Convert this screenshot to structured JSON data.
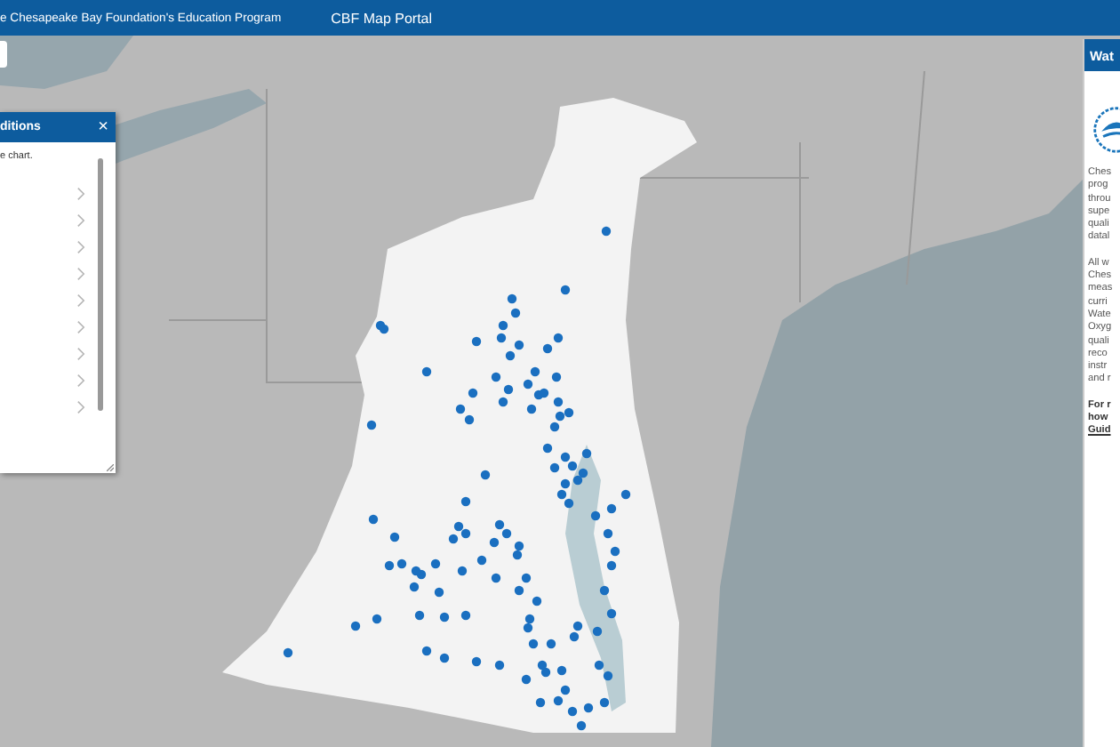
{
  "header": {
    "title": "e Chesapeake Bay Foundation's Education Program",
    "nav": [
      {
        "label": "CBF Map Portal"
      }
    ]
  },
  "left_panel": {
    "title": "ditions",
    "close": "×",
    "text": "e chart.",
    "rows": [
      {
        "kind": "chevron"
      },
      {
        "kind": "chevron"
      },
      {
        "kind": "chevron"
      },
      {
        "kind": "chevron"
      },
      {
        "kind": "chevron"
      },
      {
        "kind": "chevron"
      },
      {
        "kind": "chevron"
      },
      {
        "kind": "chevron"
      },
      {
        "kind": "chevron"
      }
    ]
  },
  "right_panel": {
    "title": "Wat",
    "paragraphs": [
      {
        "kind": "plain",
        "lines": [
          "Ches",
          "prog",
          "throu",
          "supe",
          "quali",
          "datal"
        ]
      },
      {
        "kind": "plain",
        "lines": [
          "All w",
          "Ches",
          "meas",
          "curri",
          "Wate",
          "Oxyg",
          "quali",
          "reco",
          "instr",
          "and r"
        ]
      },
      {
        "kind": "bold",
        "lines": [
          "For r",
          "how"
        ],
        "link": "Guid"
      }
    ]
  }
}
